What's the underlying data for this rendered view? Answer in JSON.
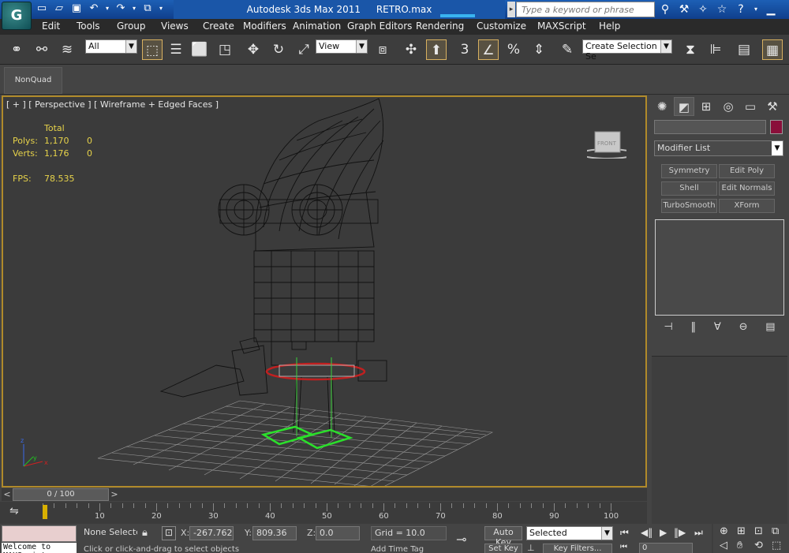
{
  "title_bar": {
    "app_title": "Autodesk 3ds Max 2011",
    "file_name": "RETRO.max",
    "search_placeholder": "Type a keyword or phrase",
    "app_button_label": "G"
  },
  "menu": {
    "items": [
      "Edit",
      "Tools",
      "Group",
      "Views",
      "Create",
      "Modifiers",
      "Animation",
      "Graph Editors",
      "Rendering",
      "Customize",
      "MAXScript",
      "Help"
    ]
  },
  "toolbar": {
    "selection_filter": "All",
    "ref_coord": "View",
    "snap_label": "3",
    "named_selection": "Create Selection Se"
  },
  "ribbon": {
    "nonquad_label": "NonQuad"
  },
  "viewport": {
    "label": "[ + ] [ Perspective ] [ Wireframe + Edged Faces ]",
    "stats_header": "Total",
    "polys_label": "Polys:",
    "polys_value": "1,170",
    "polys_sel": "0",
    "verts_label": "Verts:",
    "verts_value": "1,176",
    "verts_sel": "0",
    "fps_label": "FPS:",
    "fps_value": "78.535",
    "viewcube_face": "FRONT"
  },
  "command_panel": {
    "modifier_list": "Modifier List",
    "buttons": [
      "Symmetry",
      "Edit Poly",
      "Shell",
      "Edit Normals",
      "TurboSmooth",
      "XForm"
    ],
    "object_color": "#8a0f3a"
  },
  "timeline": {
    "slider_label": "0 / 100",
    "ruler_labels": [
      "10",
      "20",
      "30",
      "40",
      "50",
      "60",
      "70",
      "80",
      "90",
      "100"
    ]
  },
  "status": {
    "selection": "None Selected",
    "welcome": "Welcome to MAXScript",
    "x_label": "X:",
    "x_value": "-267.762",
    "y_label": "Y:",
    "y_value": "809.36",
    "z_label": "Z:",
    "z_value": "0.0",
    "grid": "Grid = 10.0",
    "prompt": "Click or click-and-drag to select objects",
    "add_time_tag": "Add Time Tag",
    "auto_key": "Auto Key",
    "set_key": "Set Key",
    "selected_mode": "Selected",
    "key_filters": "Key Filters...",
    "frame": "0"
  }
}
